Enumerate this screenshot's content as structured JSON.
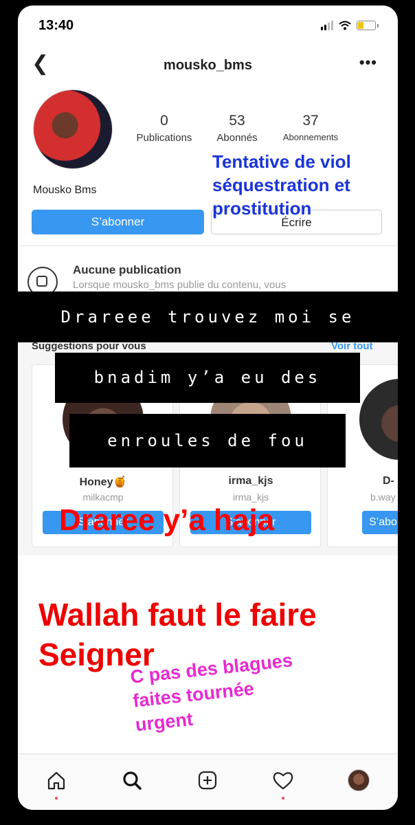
{
  "status_bar": {
    "time": "13:40"
  },
  "nav": {
    "username": "mousko_bms"
  },
  "profile": {
    "name": "Mousko Bms",
    "stats": [
      {
        "value": "0",
        "label": "Publications"
      },
      {
        "value": "53",
        "label": "Abonnés"
      },
      {
        "value": "37",
        "label": "Abonnements"
      }
    ],
    "follow_label": "S’abonner",
    "write_label": "Écrire"
  },
  "empty": {
    "title": "Aucune publication",
    "description": "Lorsque mousko_bms publie du contenu, vous"
  },
  "suggestions": {
    "title": "Suggestions pour vous",
    "see_all": "Voir tout",
    "cards": [
      {
        "name": "Honey🍯",
        "handle": "milkacmp",
        "button": "S’abonner"
      },
      {
        "name": "irma_kjs",
        "handle": "irma_kjs",
        "button": "S’abonner"
      },
      {
        "name": "D-",
        "handle": "b.way",
        "button": "S’abo"
      }
    ]
  },
  "overlays": {
    "blue_lines": [
      "Tentative de viol",
      "séquestration et",
      "prostitution"
    ],
    "captions": [
      "Drareee trouvez moi se",
      "bnadim y’a eu des",
      "enroules de fou"
    ],
    "red_mid": "Draree y’a haja",
    "red_big": [
      "Wallah faut le faire",
      "Seigner"
    ],
    "pink": [
      "C pas des blagues",
      "faites tournée",
      "urgent"
    ]
  },
  "colors": {
    "accent": "#3897f0",
    "blue_text": "#1a35d8",
    "red_text": "#ff0000",
    "pink_text": "#e62bd0"
  }
}
